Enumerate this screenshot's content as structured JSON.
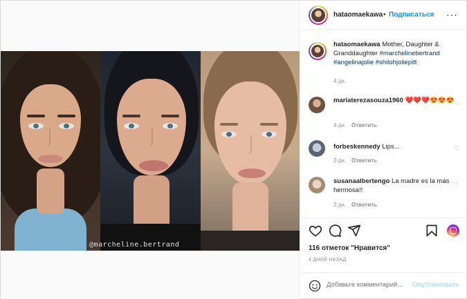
{
  "post": {
    "username": "hataomaekawa",
    "separator": "•",
    "follow_label": "Подписаться",
    "more_label": "···",
    "caption_user": "hataomaekawa",
    "caption_text": "Mother, Daughter & Granddaughter",
    "caption_tags": "#marchelinebertrand #angelinajolie #shilohjoliepitt",
    "caption_time": "4 дн.",
    "watermark": "@marcheline.bertrand"
  },
  "comments": [
    {
      "user": "mariaterezasouza1960",
      "text": "❤️❤️❤️😍😍😍",
      "time": "4 дн.",
      "reply": "Ответить"
    },
    {
      "user": "forbeskennedy",
      "text": "Lips...",
      "time": "3 дн.",
      "reply": "Ответить"
    },
    {
      "user": "susanaalbertengo",
      "text": "La madre es la más hermosa!!",
      "time": "3 дн.",
      "reply": "Ответить"
    }
  ],
  "footer": {
    "likes": "116 отметок \"Нравится\"",
    "ago": "4 ДНЕЙ НАЗАД",
    "add_placeholder": "Добавьте комментарий...",
    "publish_label": "Опубликовать"
  },
  "colors": {
    "link_blue": "#0095f6",
    "tag_blue": "#00376b",
    "muted": "#8e8e8e",
    "heart_red": "#ed4956"
  },
  "icons": [
    "heart-icon",
    "comment-icon",
    "share-icon",
    "bookmark-icon",
    "instagram-badge-icon",
    "emoji-icon",
    "more-icon"
  ]
}
